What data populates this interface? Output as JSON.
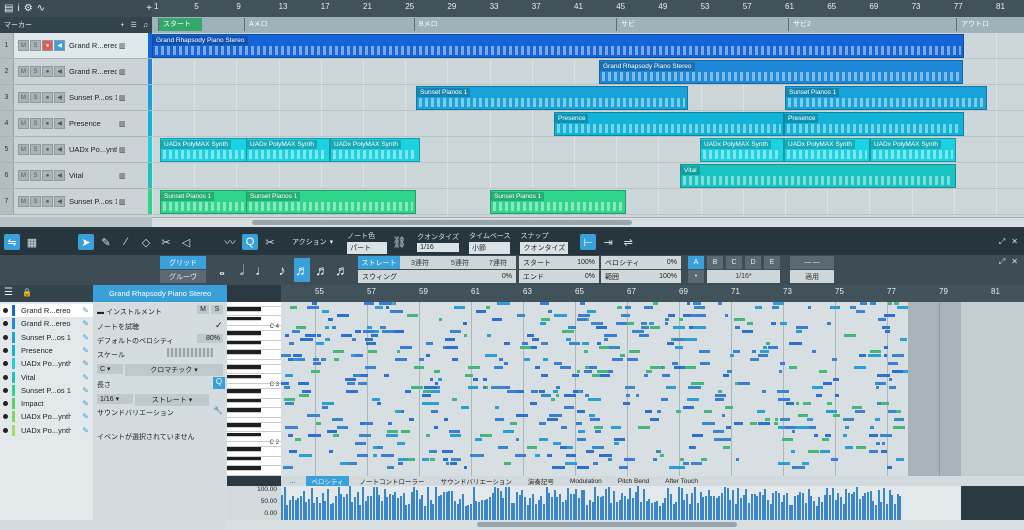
{
  "top_toolbar": {
    "marker_head": "マーカー"
  },
  "ruler": {
    "bars": [
      "1",
      "5",
      "9",
      "13",
      "17",
      "21",
      "25",
      "29",
      "33",
      "37",
      "41",
      "45",
      "49",
      "53",
      "57",
      "61",
      "65",
      "69",
      "73",
      "77",
      "81"
    ]
  },
  "markers": [
    {
      "label": "スタート",
      "color": "#33a86a"
    },
    {
      "label": "Aメロ"
    },
    {
      "label": "Bメロ"
    },
    {
      "label": "サビ"
    },
    {
      "label": "サビ2"
    },
    {
      "label": "アウトロ"
    }
  ],
  "tracks": [
    {
      "num": "1",
      "name": "Grand R...ereo",
      "color": "#1565d8"
    },
    {
      "num": "2",
      "name": "Grand R...ereo",
      "color": "#1e88d8"
    },
    {
      "num": "3",
      "name": "Sunset P...os 1",
      "color": "#1aa3d9"
    },
    {
      "num": "4",
      "name": "Presence",
      "color": "#11b4d8"
    },
    {
      "num": "5",
      "name": "UADx Po...ynth",
      "color": "#1cd1e0"
    },
    {
      "num": "6",
      "name": "Vital",
      "color": "#18c4c0"
    },
    {
      "num": "7",
      "name": "Sunset P...os 1",
      "color": "#2ed58a"
    }
  ],
  "clips": {
    "grand1": "Grand Rhapsody Piano Stereo",
    "grand2": "Grand Rhapsody Piano Stereo",
    "sunset_a": "Sunset Pianos 1",
    "sunset_b": "Sunset Pianos 1",
    "presence_a": "Presence",
    "presence_b": "Presence",
    "uadx": "UADx PolyMAX Synth",
    "vital": "Vital",
    "sunset7": "Sunset Pianos 1"
  },
  "edit_toolbar": {
    "action": "アクション",
    "note_color_label": "ノート色",
    "note_color_value": "パート",
    "quantize_label": "クオンタイズ",
    "quantize_value": "1/16",
    "timebase_label": "タイムベース",
    "timebase_value": "小節",
    "snap_label": "スナップ",
    "snap_value": "クオンタイズ"
  },
  "quant": {
    "grid": "グリッド",
    "groove": "グルーヴ",
    "straight": "ストレート",
    "triplet": "3連符",
    "quintuplet": "5連符",
    "septuplet": "7連符",
    "swing": "スウィング",
    "swing_val": "0%",
    "start": "スタート",
    "start_val": "100%",
    "end": "エンド",
    "end_val": "0%",
    "velocity": "ベロシティ",
    "velocity_val": "0%",
    "range": "範囲",
    "range_val": "100%",
    "slots": [
      "A",
      "B",
      "C",
      "D",
      "E"
    ],
    "slot_value": "1/16*",
    "apply": "適用"
  },
  "left_list": [
    {
      "name": "Grand R...ereo",
      "color": "#1565d8"
    },
    {
      "name": "Grand R...ereo",
      "color": "#1e88d8"
    },
    {
      "name": "Sunset P...os 1",
      "color": "#1aa3d9"
    },
    {
      "name": "Presence",
      "color": "#11b4d8"
    },
    {
      "name": "UADx Po...ynth",
      "color": "#1cd1e0"
    },
    {
      "name": "Vital",
      "color": "#18c4c0"
    },
    {
      "name": "Sunset P...os 1",
      "color": "#2ed58a"
    },
    {
      "name": "Impact",
      "color": "#5ccf6a"
    },
    {
      "name": "UADx Po...ynth",
      "color": "#7fd86a"
    },
    {
      "name": "UADx Po...ynth",
      "color": "#9ce06a"
    }
  ],
  "inspector": {
    "title": "Grand Rhapsody Piano Stereo",
    "instrument_edit": "インストルメント",
    "note_audition": "ノートを試聴",
    "default_velocity": "デフォルトのベロシティ",
    "default_velocity_val": "80%",
    "scale": "スケール",
    "scale_key": "C",
    "scale_type": "クロマチック",
    "length": "長さ",
    "length_val": "1/16",
    "length_type": "ストレート",
    "sound_variation": "サウンドバリエーション",
    "no_event": "イベントが選択されていません"
  },
  "roll_ruler": {
    "bars": [
      "55",
      "57",
      "59",
      "61",
      "63",
      "65",
      "67",
      "69",
      "71",
      "73",
      "75",
      "77",
      "79",
      "81"
    ]
  },
  "keyboard_labels": [
    "C 4",
    "C 3",
    "C 2"
  ],
  "vel_tabs": [
    "...",
    "ベロシティ",
    "ノートコントローラー",
    "サウンドバリエーション",
    "演奏記号",
    "Modulation",
    "Pitch Bend",
    "After Touch"
  ],
  "vel_scale": [
    "100.00",
    "50.00",
    "0.00"
  ]
}
